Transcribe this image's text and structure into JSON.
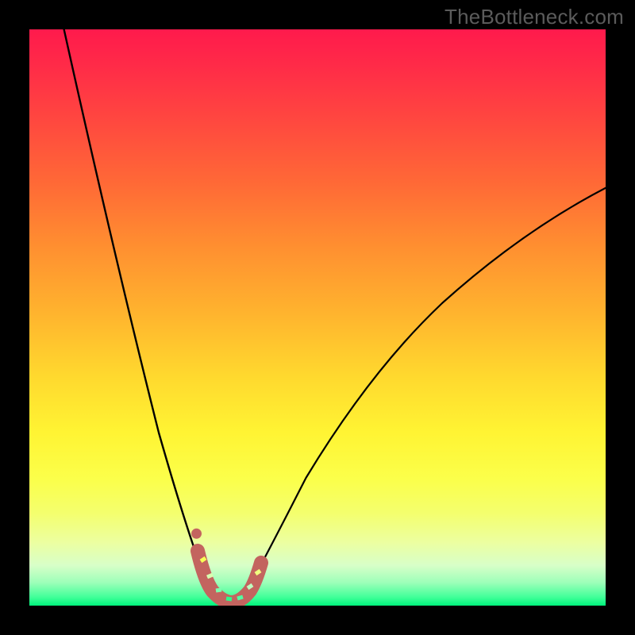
{
  "watermark": "TheBottleneck.com",
  "colors": {
    "frame": "#000000",
    "curve": "#000000",
    "marker": "#c3645f",
    "gradient_top": "#ff1a4c",
    "gradient_bottom": "#00f57c"
  },
  "chart_data": {
    "type": "line",
    "title": "",
    "xlabel": "",
    "ylabel": "",
    "xlim": [
      0,
      100
    ],
    "ylim": [
      0,
      100
    ],
    "grid": false,
    "legend": false,
    "annotations": [
      "TheBottleneck.com"
    ],
    "series": [
      {
        "name": "left-branch",
        "x": [
          6,
          8,
          10,
          12,
          14,
          16,
          18,
          20,
          22,
          24,
          26,
          28,
          30,
          31.5
        ],
        "y": [
          100,
          91,
          82,
          73,
          64,
          55,
          46.5,
          38.5,
          31,
          24,
          17.5,
          11.5,
          6,
          3
        ]
      },
      {
        "name": "right-branch",
        "x": [
          38,
          40,
          44,
          48,
          52,
          56,
          60,
          64,
          70,
          76,
          82,
          88,
          94,
          100
        ],
        "y": [
          3,
          5.5,
          11,
          16.5,
          22,
          27.5,
          33,
          38,
          45,
          51.5,
          57.5,
          63,
          68,
          72.5
        ]
      },
      {
        "name": "valley-floor",
        "x": [
          31.5,
          33,
          34.5,
          36,
          37.5,
          38
        ],
        "y": [
          3,
          1,
          0.5,
          0.5,
          1.5,
          3
        ]
      }
    ],
    "markers": {
      "name": "highlight-band",
      "color": "#c3645f",
      "points_xy": [
        [
          29.2,
          9.5
        ],
        [
          30.0,
          6.5
        ],
        [
          30.9,
          4.1
        ],
        [
          31.8,
          2.3
        ],
        [
          32.8,
          1.1
        ],
        [
          33.8,
          0.6
        ],
        [
          34.8,
          0.5
        ],
        [
          35.8,
          0.8
        ],
        [
          36.7,
          1.6
        ],
        [
          37.6,
          2.9
        ],
        [
          38.6,
          4.8
        ],
        [
          39.6,
          7.3
        ]
      ],
      "extra_dot_xy": [
        29.0,
        12.5
      ]
    }
  }
}
